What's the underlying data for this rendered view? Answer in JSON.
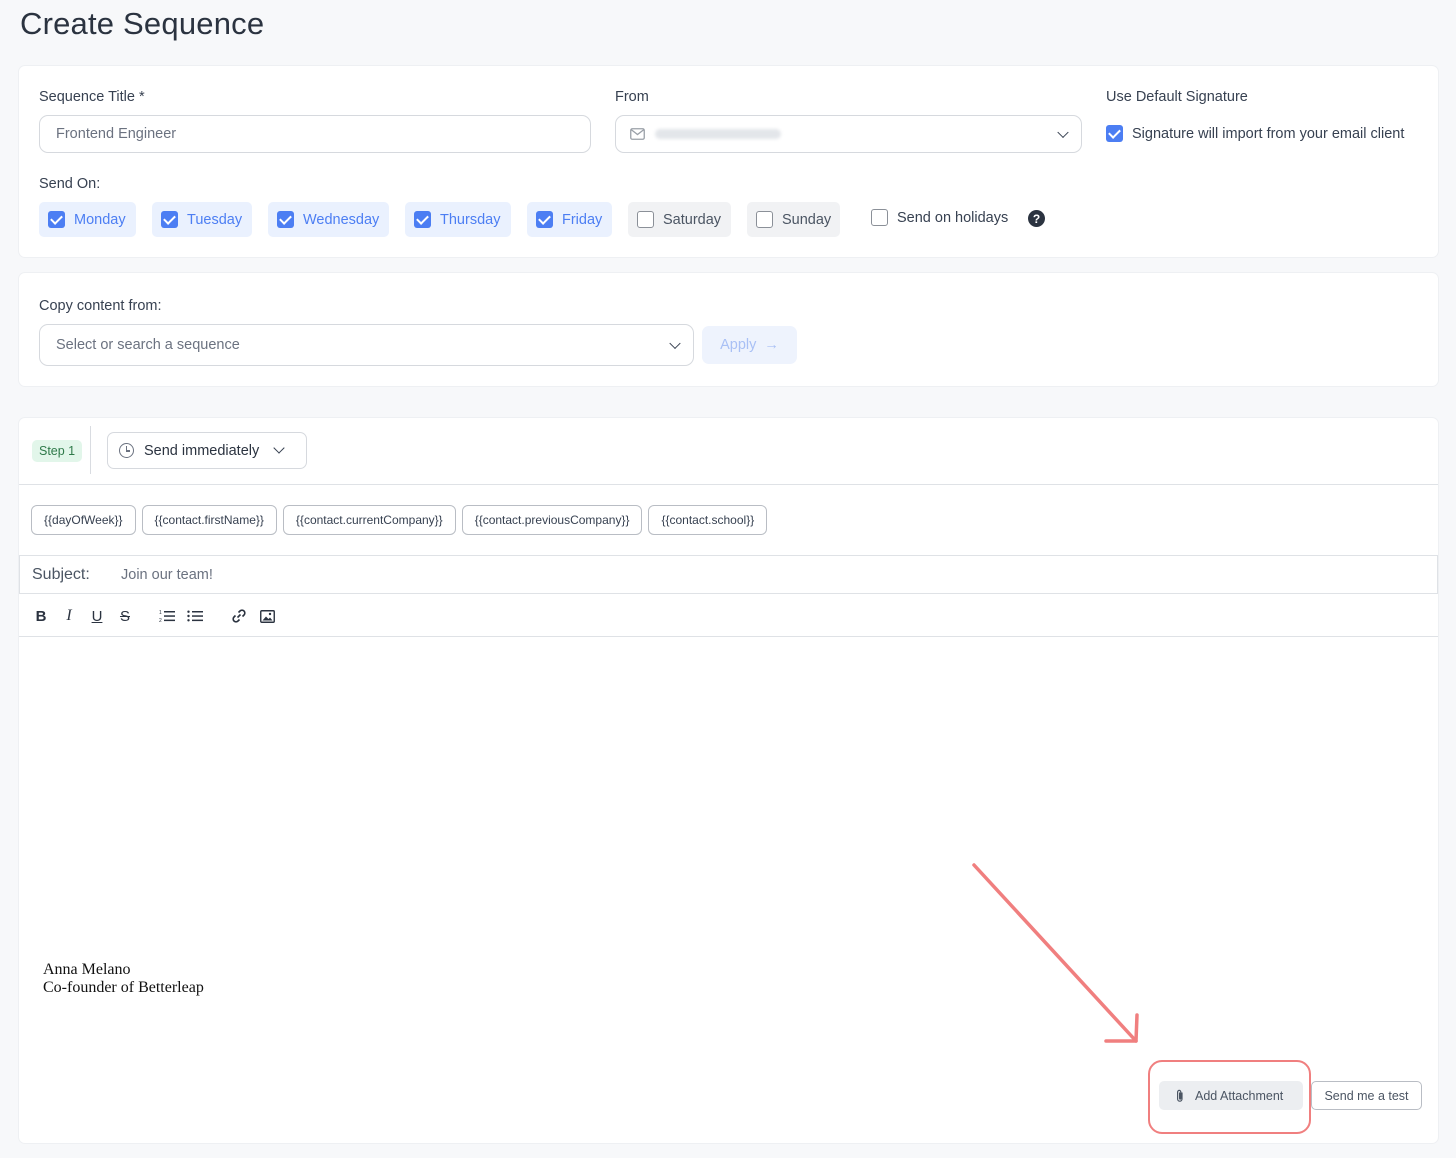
{
  "page": {
    "title": "Create Sequence"
  },
  "settings": {
    "sequence_title_label": "Sequence Title *",
    "sequence_title_value": "Frontend Engineer",
    "from_label": "From",
    "signature_label": "Use Default Signature",
    "signature_text": "Signature will import from your email client",
    "signature_checked": true,
    "send_on_label": "Send On:",
    "days": [
      {
        "label": "Monday",
        "checked": true
      },
      {
        "label": "Tuesday",
        "checked": true
      },
      {
        "label": "Wednesday",
        "checked": true
      },
      {
        "label": "Thursday",
        "checked": true
      },
      {
        "label": "Friday",
        "checked": true
      },
      {
        "label": "Saturday",
        "checked": false
      },
      {
        "label": "Sunday",
        "checked": false
      }
    ],
    "holidays_label": "Send on holidays",
    "holidays_checked": false,
    "help_glyph": "?"
  },
  "copy": {
    "label": "Copy content from:",
    "placeholder": "Select or search a sequence",
    "apply_label": "Apply",
    "apply_arrow": "→"
  },
  "step": {
    "badge": "Step 1",
    "timing": "Send immediately",
    "variables": [
      "{{dayOfWeek}}",
      "{{contact.firstName}}",
      "{{contact.currentCompany}}",
      "{{contact.previousCompany}}",
      "{{contact.school}}"
    ],
    "subject_label": "Subject:",
    "subject_value": "Join our team!",
    "toolbar": {
      "bold": "B",
      "italic": "I",
      "underline": "U",
      "strike": "S"
    },
    "signature_lines": [
      "Anna Melano",
      "Co-founder of Betterleap"
    ],
    "attach_label": "Add Attachment",
    "test_label": "Send me a test"
  },
  "colors": {
    "accent": "#4c7ef3",
    "highlight": "#f07f7f",
    "step_badge_bg": "#e2f6ea"
  }
}
